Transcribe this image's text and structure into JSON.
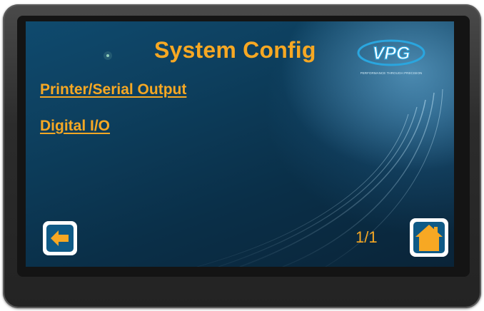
{
  "screen": {
    "title": "System Config",
    "logo_text": "VPG",
    "logo_tagline": "PERFORMANCE THROUGH PRECISION",
    "page_indicator": "1/1"
  },
  "menu": {
    "items": [
      {
        "label": "Printer/Serial Output"
      },
      {
        "label": "Digital I/O"
      }
    ]
  },
  "nav": {
    "back_icon": "arrow-left-icon",
    "home_icon": "home-icon"
  },
  "colors": {
    "accent": "#f7a823",
    "button_blue": "#0f5a86",
    "screen_bg": "#0d3f5e",
    "bezel": "#2c2c2c"
  }
}
